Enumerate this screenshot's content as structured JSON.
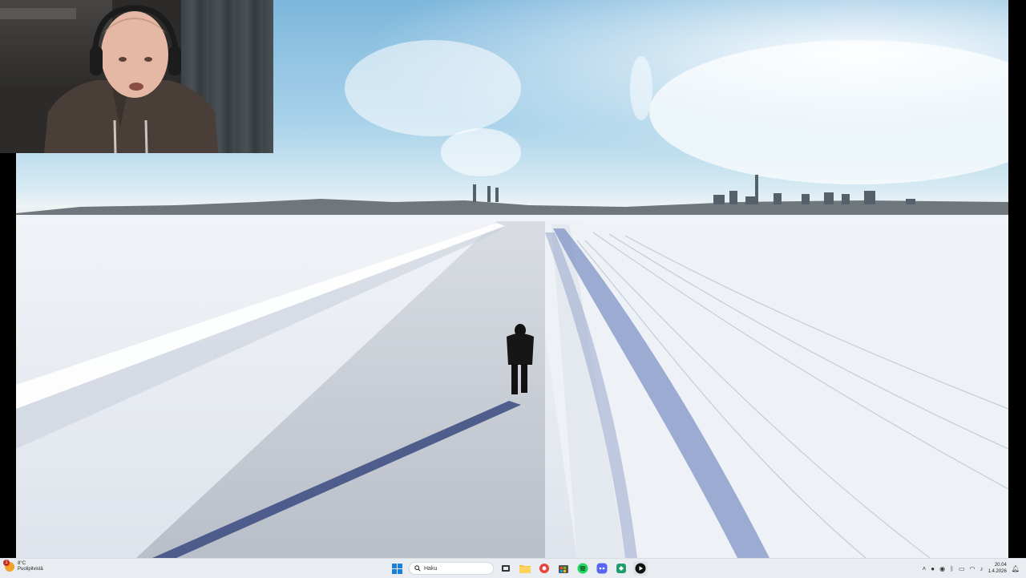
{
  "weather": {
    "temperature": "8°C",
    "condition": "Puolipilvistä",
    "badge": "1"
  },
  "taskbar": {
    "search_placeholder": "Haku",
    "pinned": [
      "start-button",
      "search-box",
      "task-view",
      "file-explorer",
      "browser",
      "app-store",
      "spotify",
      "discord",
      "app-green",
      "media-player"
    ]
  },
  "clock": {
    "time": "20.04",
    "date": "1.4.2026"
  },
  "colors": {
    "taskbar_bg": "#e9edf1",
    "windows_accent": "#1e7fd8",
    "spotify": "#1ed760",
    "discord": "#5865f2"
  }
}
